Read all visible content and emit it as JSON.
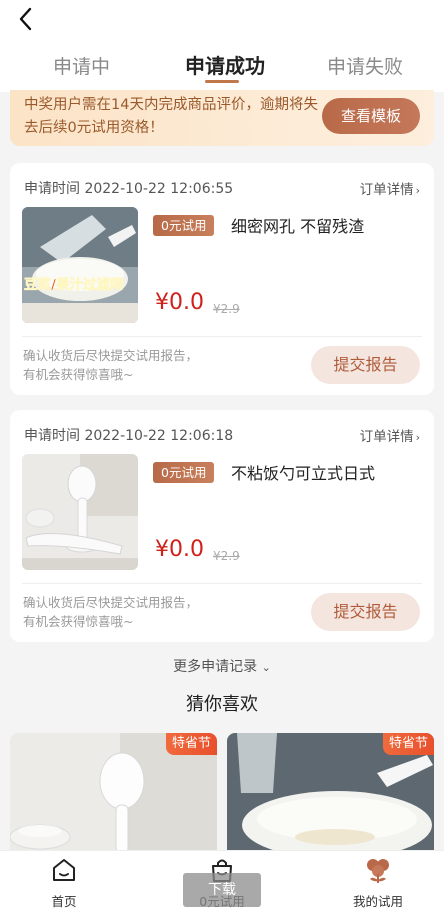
{
  "header": {
    "back_icon": "chevron-left-icon"
  },
  "tabs": [
    {
      "label": "申请中"
    },
    {
      "label": "申请成功"
    },
    {
      "label": "申请失败"
    }
  ],
  "notice": {
    "text": "中奖用户需在14天内完成商品评价，逾期将失去后续0元试用资格！",
    "button": "查看模板"
  },
  "orders": [
    {
      "apply_time": "申请时间 2022-10-22 12:06:55",
      "detail_link": "订单详情",
      "tag": "0元试用",
      "name": "细密网孔 不留残渣",
      "price": "¥0.0",
      "original_price": "¥2.9",
      "image_caption": "豆浆/果汁过滤网",
      "hint": "确认收货后尽快提交试用报告，有机会获得惊喜哦~",
      "report_button": "提交报告"
    },
    {
      "apply_time": "申请时间 2022-10-22 12:06:18",
      "detail_link": "订单详情",
      "tag": "0元试用",
      "name": "不粘饭勺可立式日式",
      "price": "¥0.0",
      "original_price": "¥2.9",
      "hint": "确认收货后尽快提交试用报告，有机会获得惊喜哦~",
      "report_button": "提交报告"
    }
  ],
  "more_link": "更多申请记录",
  "recommend": {
    "title": "猜你喜欢",
    "items": [
      {
        "badge": "特省节"
      },
      {
        "badge": "特省节"
      }
    ]
  },
  "bottom_nav": [
    {
      "label": "首页",
      "icon": "home-icon"
    },
    {
      "label": "0元试用",
      "icon": "shopping-bag-icon"
    },
    {
      "label": "我的试用",
      "icon": "flower-icon"
    }
  ],
  "overlay": {
    "download": "下载"
  },
  "colors": {
    "accent": "#c0784a",
    "price": "#d0201a",
    "badge": "#e8502c"
  }
}
